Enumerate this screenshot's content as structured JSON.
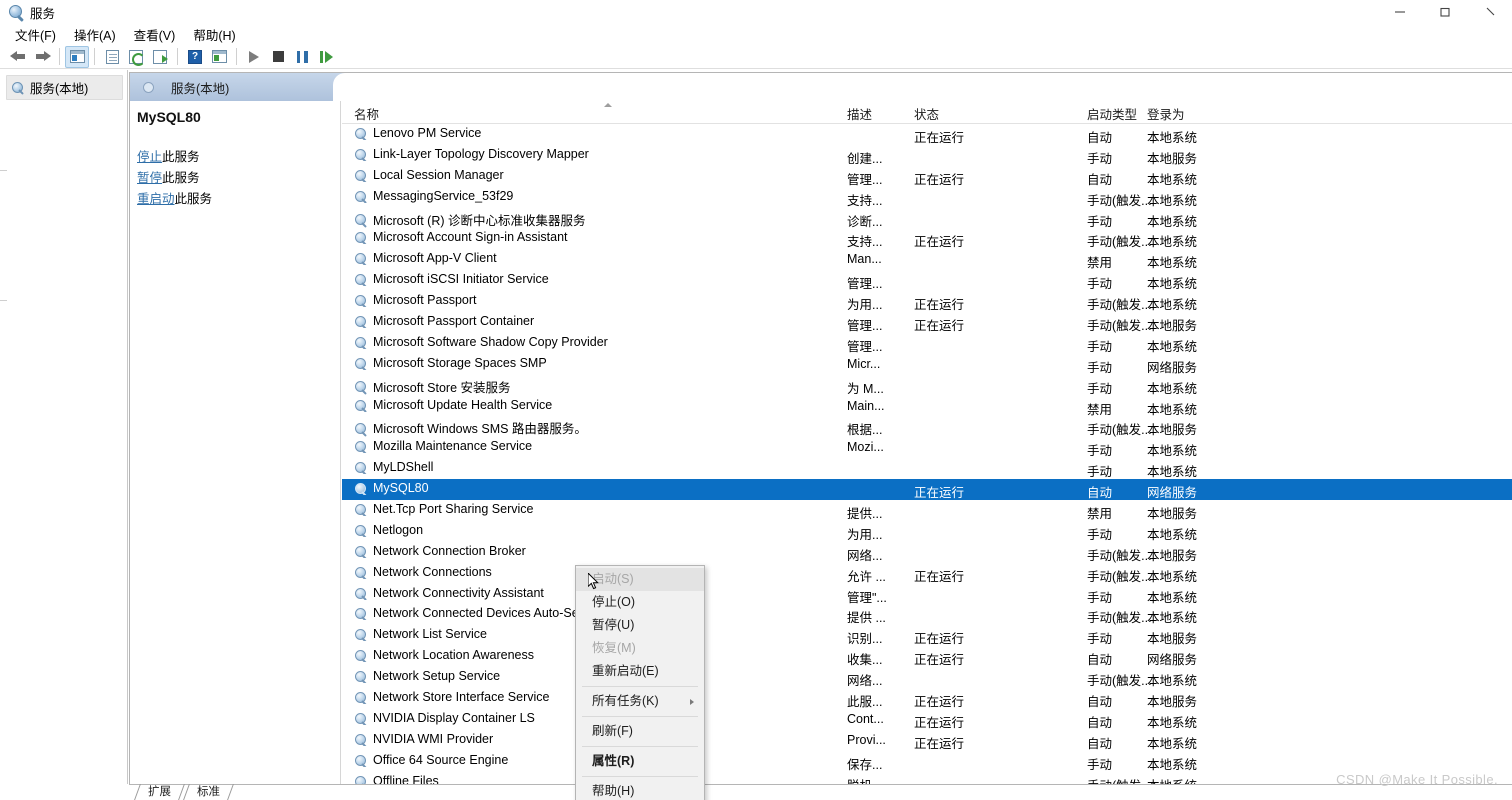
{
  "window": {
    "title": "服务",
    "icon": "services-gear-icon",
    "minimize": "−",
    "maximize": "▢",
    "close": "✕"
  },
  "menubar": [
    {
      "label": "文件(F)"
    },
    {
      "label": "操作(A)"
    },
    {
      "label": "查看(V)"
    },
    {
      "label": "帮助(H)"
    }
  ],
  "toolbar": [
    {
      "name": "back-arrow-icon"
    },
    {
      "name": "forward-arrow-icon"
    },
    {
      "name": "show-hide-console-tree-icon"
    },
    {
      "name": "properties-icon"
    },
    {
      "name": "refresh-icon"
    },
    {
      "name": "export-list-icon"
    },
    {
      "name": "help-icon",
      "glyph": "?"
    },
    {
      "name": "show-hide-action-pane-icon"
    },
    {
      "name": "start-service-icon"
    },
    {
      "name": "stop-service-icon"
    },
    {
      "name": "pause-service-icon"
    },
    {
      "name": "restart-service-icon"
    }
  ],
  "tree": {
    "root_label": "服务(本地)"
  },
  "pane": {
    "header_title": "服务(本地)"
  },
  "detail": {
    "service_name": "MySQL80",
    "links": [
      {
        "link": "停止",
        "suffix": "此服务"
      },
      {
        "link": "暂停",
        "suffix": "此服务"
      },
      {
        "link": "重启动",
        "suffix": "此服务"
      }
    ]
  },
  "columns": {
    "name": "名称",
    "description": "描述",
    "status": "状态",
    "startup_type": "启动类型",
    "log_on_as": "登录为"
  },
  "rows": [
    {
      "name": "Lenovo PM Service",
      "desc": "",
      "status": "正在运行",
      "startup": "自动",
      "logon": "本地系统",
      "selected": false
    },
    {
      "name": "Link-Layer Topology Discovery Mapper",
      "desc": "创建...",
      "status": "",
      "startup": "手动",
      "logon": "本地服务",
      "selected": false
    },
    {
      "name": "Local Session Manager",
      "desc": "管理...",
      "status": "正在运行",
      "startup": "自动",
      "logon": "本地系统",
      "selected": false
    },
    {
      "name": "MessagingService_53f29",
      "desc": "支持...",
      "status": "",
      "startup": "手动(触发...",
      "logon": "本地系统",
      "selected": false
    },
    {
      "name": "Microsoft (R) 诊断中心标准收集器服务",
      "desc": "诊断...",
      "status": "",
      "startup": "手动",
      "logon": "本地系统",
      "selected": false
    },
    {
      "name": "Microsoft Account Sign-in Assistant",
      "desc": "支持...",
      "status": "正在运行",
      "startup": "手动(触发...",
      "logon": "本地系统",
      "selected": false
    },
    {
      "name": "Microsoft App-V Client",
      "desc": "Man...",
      "status": "",
      "startup": "禁用",
      "logon": "本地系统",
      "selected": false
    },
    {
      "name": "Microsoft iSCSI Initiator Service",
      "desc": "管理...",
      "status": "",
      "startup": "手动",
      "logon": "本地系统",
      "selected": false
    },
    {
      "name": "Microsoft Passport",
      "desc": "为用...",
      "status": "正在运行",
      "startup": "手动(触发...",
      "logon": "本地系统",
      "selected": false
    },
    {
      "name": "Microsoft Passport Container",
      "desc": "管理...",
      "status": "正在运行",
      "startup": "手动(触发...",
      "logon": "本地服务",
      "selected": false
    },
    {
      "name": "Microsoft Software Shadow Copy Provider",
      "desc": "管理...",
      "status": "",
      "startup": "手动",
      "logon": "本地系统",
      "selected": false
    },
    {
      "name": "Microsoft Storage Spaces SMP",
      "desc": "Micr...",
      "status": "",
      "startup": "手动",
      "logon": "网络服务",
      "selected": false
    },
    {
      "name": "Microsoft Store 安装服务",
      "desc": "为 M...",
      "status": "",
      "startup": "手动",
      "logon": "本地系统",
      "selected": false
    },
    {
      "name": "Microsoft Update Health Service",
      "desc": "Main...",
      "status": "",
      "startup": "禁用",
      "logon": "本地系统",
      "selected": false
    },
    {
      "name": "Microsoft Windows SMS 路由器服务。",
      "desc": "根据...",
      "status": "",
      "startup": "手动(触发...",
      "logon": "本地服务",
      "selected": false
    },
    {
      "name": "Mozilla Maintenance Service",
      "desc": "Mozi...",
      "status": "",
      "startup": "手动",
      "logon": "本地系统",
      "selected": false
    },
    {
      "name": "MyLDShell",
      "desc": "",
      "status": "",
      "startup": "手动",
      "logon": "本地系统",
      "selected": false
    },
    {
      "name": "MySQL80",
      "desc": "",
      "status": "正在运行",
      "startup": "自动",
      "logon": "网络服务",
      "selected": true
    },
    {
      "name": "Net.Tcp Port Sharing Service",
      "desc": "提供...",
      "status": "",
      "startup": "禁用",
      "logon": "本地服务",
      "selected": false
    },
    {
      "name": "Netlogon",
      "desc": "为用...",
      "status": "",
      "startup": "手动",
      "logon": "本地系统",
      "selected": false
    },
    {
      "name": "Network Connection Broker",
      "desc": "网络...",
      "status": "",
      "startup": "手动(触发...",
      "logon": "本地服务",
      "selected": false
    },
    {
      "name": "Network Connections",
      "desc": "允许 ...",
      "status": "正在运行",
      "startup": "手动(触发...",
      "logon": "本地系统",
      "selected": false
    },
    {
      "name": "Network Connectivity Assistant",
      "desc": "管理\"...",
      "status": "",
      "startup": "手动",
      "logon": "本地系统",
      "selected": false
    },
    {
      "name": "Network Connected Devices Auto-Setup",
      "desc": "提供 ...",
      "status": "",
      "startup": "手动(触发...",
      "logon": "本地系统",
      "selected": false
    },
    {
      "name": "Network List Service",
      "desc": "识别...",
      "status": "正在运行",
      "startup": "手动",
      "logon": "本地服务",
      "selected": false
    },
    {
      "name": "Network Location Awareness",
      "desc": "收集...",
      "status": "正在运行",
      "startup": "自动",
      "logon": "网络服务",
      "selected": false
    },
    {
      "name": "Network Setup Service",
      "desc": "网络...",
      "status": "",
      "startup": "手动(触发...",
      "logon": "本地系统",
      "selected": false
    },
    {
      "name": "Network Store Interface Service",
      "desc": "此服...",
      "status": "正在运行",
      "startup": "自动",
      "logon": "本地服务",
      "selected": false
    },
    {
      "name": "NVIDIA Display Container LS",
      "desc": "Cont...",
      "status": "正在运行",
      "startup": "自动",
      "logon": "本地系统",
      "selected": false
    },
    {
      "name": "NVIDIA WMI Provider",
      "desc": "Provi...",
      "status": "正在运行",
      "startup": "自动",
      "logon": "本地系统",
      "selected": false
    },
    {
      "name": "Office 64 Source Engine",
      "desc": "保存...",
      "status": "",
      "startup": "手动",
      "logon": "本地系统",
      "selected": false
    },
    {
      "name": "Offline Files",
      "desc": "脱机...",
      "status": "",
      "startup": "手动(触发...",
      "logon": "本地系统",
      "selected": false
    }
  ],
  "context_menu": {
    "items": [
      {
        "label": "启动(S)",
        "disabled": true,
        "bold": false,
        "submenu": false,
        "hover": true,
        "sep_after": false
      },
      {
        "label": "停止(O)",
        "disabled": false,
        "bold": false,
        "submenu": false,
        "hover": false,
        "sep_after": false
      },
      {
        "label": "暂停(U)",
        "disabled": false,
        "bold": false,
        "submenu": false,
        "hover": false,
        "sep_after": false
      },
      {
        "label": "恢复(M)",
        "disabled": true,
        "bold": false,
        "submenu": false,
        "hover": false,
        "sep_after": false
      },
      {
        "label": "重新启动(E)",
        "disabled": false,
        "bold": false,
        "submenu": false,
        "hover": false,
        "sep_after": true
      },
      {
        "label": "所有任务(K)",
        "disabled": false,
        "bold": false,
        "submenu": true,
        "hover": false,
        "sep_after": true
      },
      {
        "label": "刷新(F)",
        "disabled": false,
        "bold": false,
        "submenu": false,
        "hover": false,
        "sep_after": true
      },
      {
        "label": "属性(R)",
        "disabled": false,
        "bold": true,
        "submenu": false,
        "hover": false,
        "sep_after": true
      },
      {
        "label": "帮助(H)",
        "disabled": false,
        "bold": false,
        "submenu": false,
        "hover": false,
        "sep_after": false
      }
    ]
  },
  "bottom_tabs": [
    {
      "label": "扩展"
    },
    {
      "label": "标准"
    }
  ],
  "watermark": "CSDN @Make It Possible.",
  "colors": {
    "selection_blue": "#0b6fc4",
    "pane_header": "#b9cbe2",
    "link_blue": "#2e6ea8"
  }
}
